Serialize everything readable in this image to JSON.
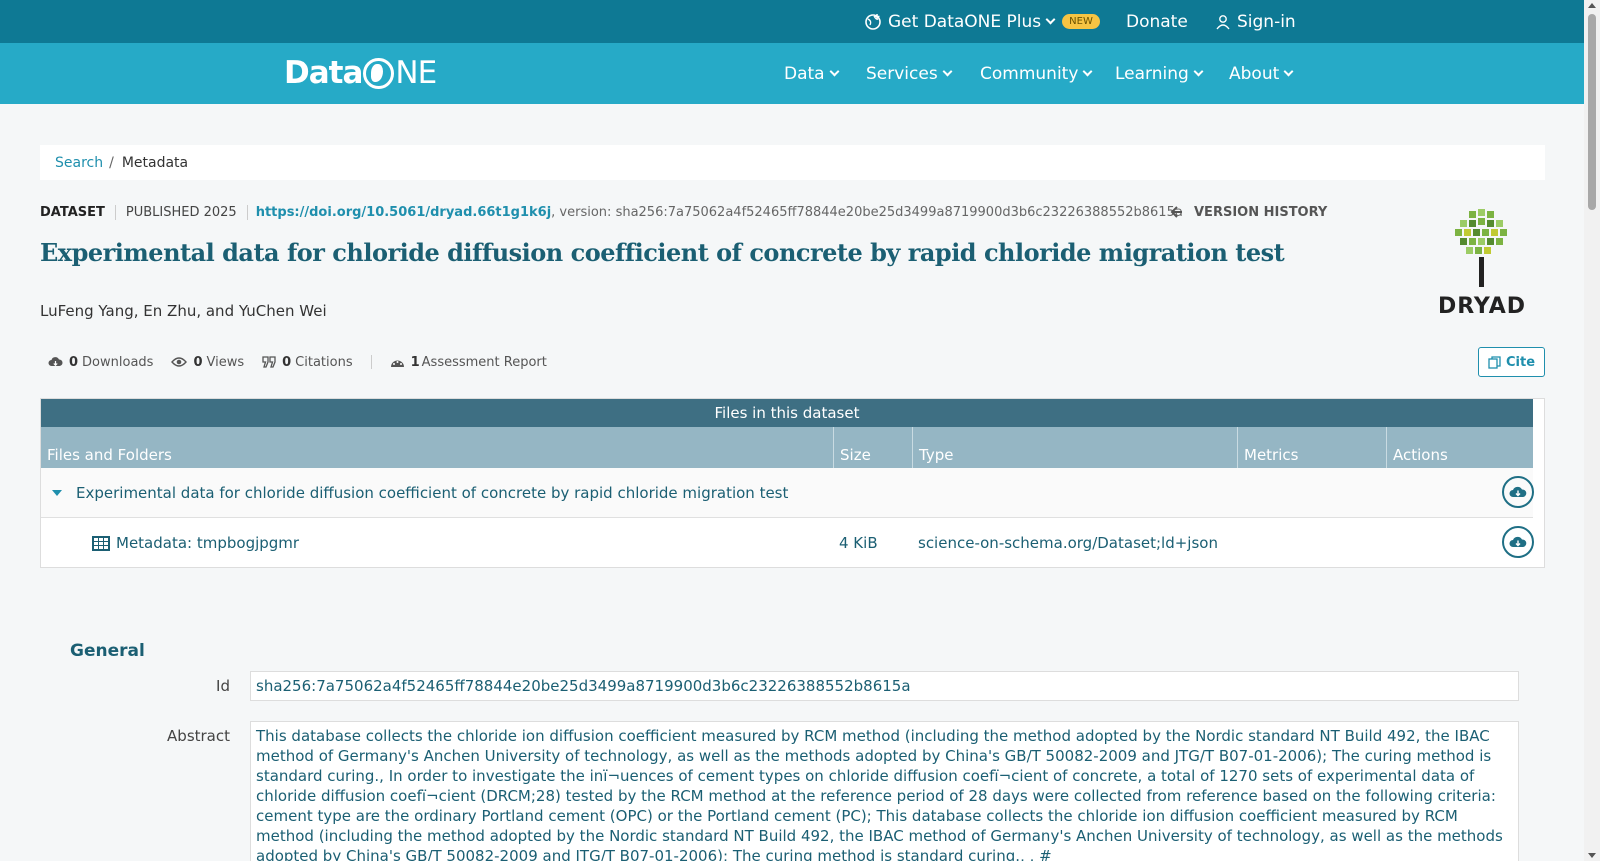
{
  "topbar": {
    "dataone_plus": "Get DataONE Plus",
    "new_badge": "NEW",
    "donate": "Donate",
    "signin": "Sign-in"
  },
  "navbar": {
    "logo_left": "Data",
    "logo_right": "NE",
    "items": [
      "Data",
      "Services",
      "Community",
      "Learning",
      "About"
    ]
  },
  "breadcrumb": {
    "search": "Search",
    "separator": "/",
    "current": "Metadata"
  },
  "dataset": {
    "type": "DATASET",
    "published": "PUBLISHED 2025",
    "doi": "https://doi.org/10.5061/dryad.66t1g1k6j",
    "version_label": ", version: sha256:7a75062a4f52465ff78844e20be25d3499a8719900d3b6c23226388552b8615a",
    "version_history": "VERSION HISTORY",
    "title": "Experimental data for chloride diffusion coefficient of concrete by rapid chloride migration test",
    "authors": "LuFeng Yang, En Zhu, and YuChen Wei",
    "repository_logo_text": "DRYAD"
  },
  "stats": {
    "downloads_count": "0",
    "downloads_label": "Downloads",
    "views_count": "0",
    "views_label": "Views",
    "citations_count": "0",
    "citations_label": "Citations",
    "assessment_count": "1",
    "assessment_label": "Assessment Report"
  },
  "cite_button": "Cite",
  "files": {
    "header": "Files in this dataset",
    "columns": [
      "Files and Folders",
      "Size",
      "Type",
      "Metrics",
      "Actions"
    ],
    "folder": {
      "name": "Experimental data for chloride diffusion coefficient of concrete by rapid chloride migration test"
    },
    "rows": [
      {
        "name": "Metadata: tmpbogjpgmr",
        "size": "4 KiB",
        "type": "science-on-schema.org/Dataset;ld+json"
      }
    ]
  },
  "general": {
    "heading": "General",
    "id_label": "Id",
    "id_value": "sha256:7a75062a4f52465ff78844e20be25d3499a8719900d3b6c23226388552b8615a",
    "abstract_label": "Abstract",
    "abstract_value": "This database collects the chloride ion diffusion coefficient measured by RCM method (including the method adopted by the Nordic standard NT Build 492, the IBAC method of Germany's Anchen University of technology, as well as the methods adopted by China's GB/T 50082-2009 and JTG/T B07-01-2006); The curing method is standard curing., In order to investigate the inï¬uences of cement types on chloride diffusion coefï¬cient of concrete, a total of 1270 sets of experimental data of chloride diffusion coefï¬cient (DRCM;28) tested by the RCM method at the reference period of 28 days were collected from reference based on the following criteria: cement type are the ordinary Portland cement (OPC) or the Portland cement (PC); This database collects the chloride ion diffusion coefficient measured by RCM method (including the method adopted by the Nordic standard NT Build 492, the IBAC method of Germany's Anchen University of technology, as well as the methods adopted by China's GB/T 50082-2009 and JTG/T B07-01-2006); The curing method is standard curing., , #"
  },
  "colors": {
    "topbar": "#0e7994",
    "navbar": "#26aac7",
    "title": "#1b5f73",
    "link": "#1f8fad",
    "files_header": "#3e6f83",
    "files_cols": "#95b6c4"
  },
  "icons": {
    "dataone_plus": "globe-plus-icon",
    "signin": "user-icon",
    "version_history": "arrow-left-icon",
    "downloads": "cloud-download-icon",
    "views": "eye-icon",
    "citations": "quote-icon",
    "assessment": "gauge-icon",
    "cite": "copy-icon",
    "folder_toggle": "caret-down-icon",
    "download_action": "cloud-download-icon",
    "metadata_file": "table-icon"
  }
}
